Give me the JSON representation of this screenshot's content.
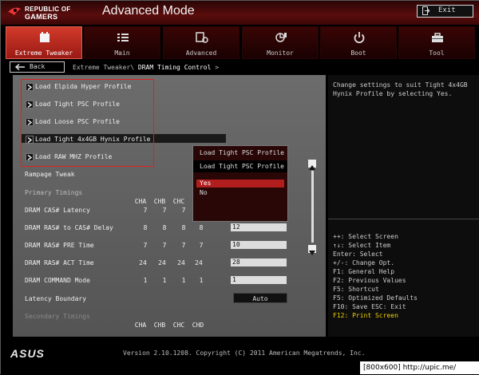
{
  "header": {
    "logo_line1": "REPUBLIC OF",
    "logo_line2": "GAMERS",
    "title": "Advanced Mode",
    "exit_label": "Exit"
  },
  "tabs": [
    {
      "label": "Extreme Tweaker",
      "icon": "extreme-tweaker-icon",
      "active": true
    },
    {
      "label": "Main",
      "icon": "list-icon"
    },
    {
      "label": "Advanced",
      "icon": "advanced-icon"
    },
    {
      "label": "Monitor",
      "icon": "monitor-fan-icon"
    },
    {
      "label": "Boot",
      "icon": "power-icon"
    },
    {
      "label": "Tool",
      "icon": "toolbox-icon"
    }
  ],
  "breadcrumb": {
    "back_label": "Back",
    "parent": "Extreme Tweaker\\",
    "current": "DRAM Timing Control",
    "suffix": ">"
  },
  "profiles": [
    "Load Elpida Hyper Profile",
    "Load Tight PSC Profile",
    "Load Loose PSC Profile",
    "Load Tight 4x4GB Hynix Profile",
    "Load RAW MHZ Profile"
  ],
  "settings": {
    "rampage_tweak": "Rampage Tweak",
    "primary_heading": "Primary Timings",
    "channels": [
      "CHA",
      "CHB",
      "CHC",
      "CHD"
    ],
    "rows": [
      {
        "label": "DRAM CAS# Latency",
        "values": [
          "7",
          "7",
          "7"
        ],
        "field": ""
      },
      {
        "label": "DRAM RAS# to CAS# Delay",
        "values": [
          "8",
          "8",
          "8",
          "8"
        ],
        "field": "12"
      },
      {
        "label": "DRAM RAS# PRE Time",
        "values": [
          "7",
          "7",
          "7",
          "7"
        ],
        "field": "10"
      },
      {
        "label": "DRAM RAS# ACT Time",
        "values": [
          "24",
          "24",
          "24",
          "24"
        ],
        "field": "28"
      },
      {
        "label": "DRAM COMMAND Mode",
        "values": [
          "1",
          "1",
          "1",
          "1"
        ],
        "field": "1"
      }
    ],
    "latency_boundary": "Latency Boundary",
    "latency_boundary_value": "Auto",
    "secondary_heading": "Secondary Timings"
  },
  "popup": {
    "title": "Load Tight PSC Profile",
    "subtitle": "Load Tight PSC Profile",
    "options": [
      "Yes",
      "No"
    ],
    "selected": "Yes"
  },
  "help": {
    "description": "Change settings to suit Tight 4x4GB Hynix Profile by selecting Yes.",
    "keys": [
      "++: Select Screen",
      "↑↓: Select Item",
      "Enter: Select",
      "+/-: Change Opt.",
      "F1: General Help",
      "F2: Previous Values",
      "F5: Shortcut",
      "F5: Optimized Defaults",
      "F10: Save  ESC: Exit",
      "F12: Print Screen"
    ]
  },
  "footer": {
    "brand": "ASUS",
    "version": "Version 2.10.1208. Copyright (C) 2011 American Megatrends, Inc.",
    "watermark": "[800x600] http://upic.me/"
  },
  "colors": {
    "accent": "#c0281c",
    "highlight": "#e02020",
    "help_yellow": "#f0d000"
  }
}
